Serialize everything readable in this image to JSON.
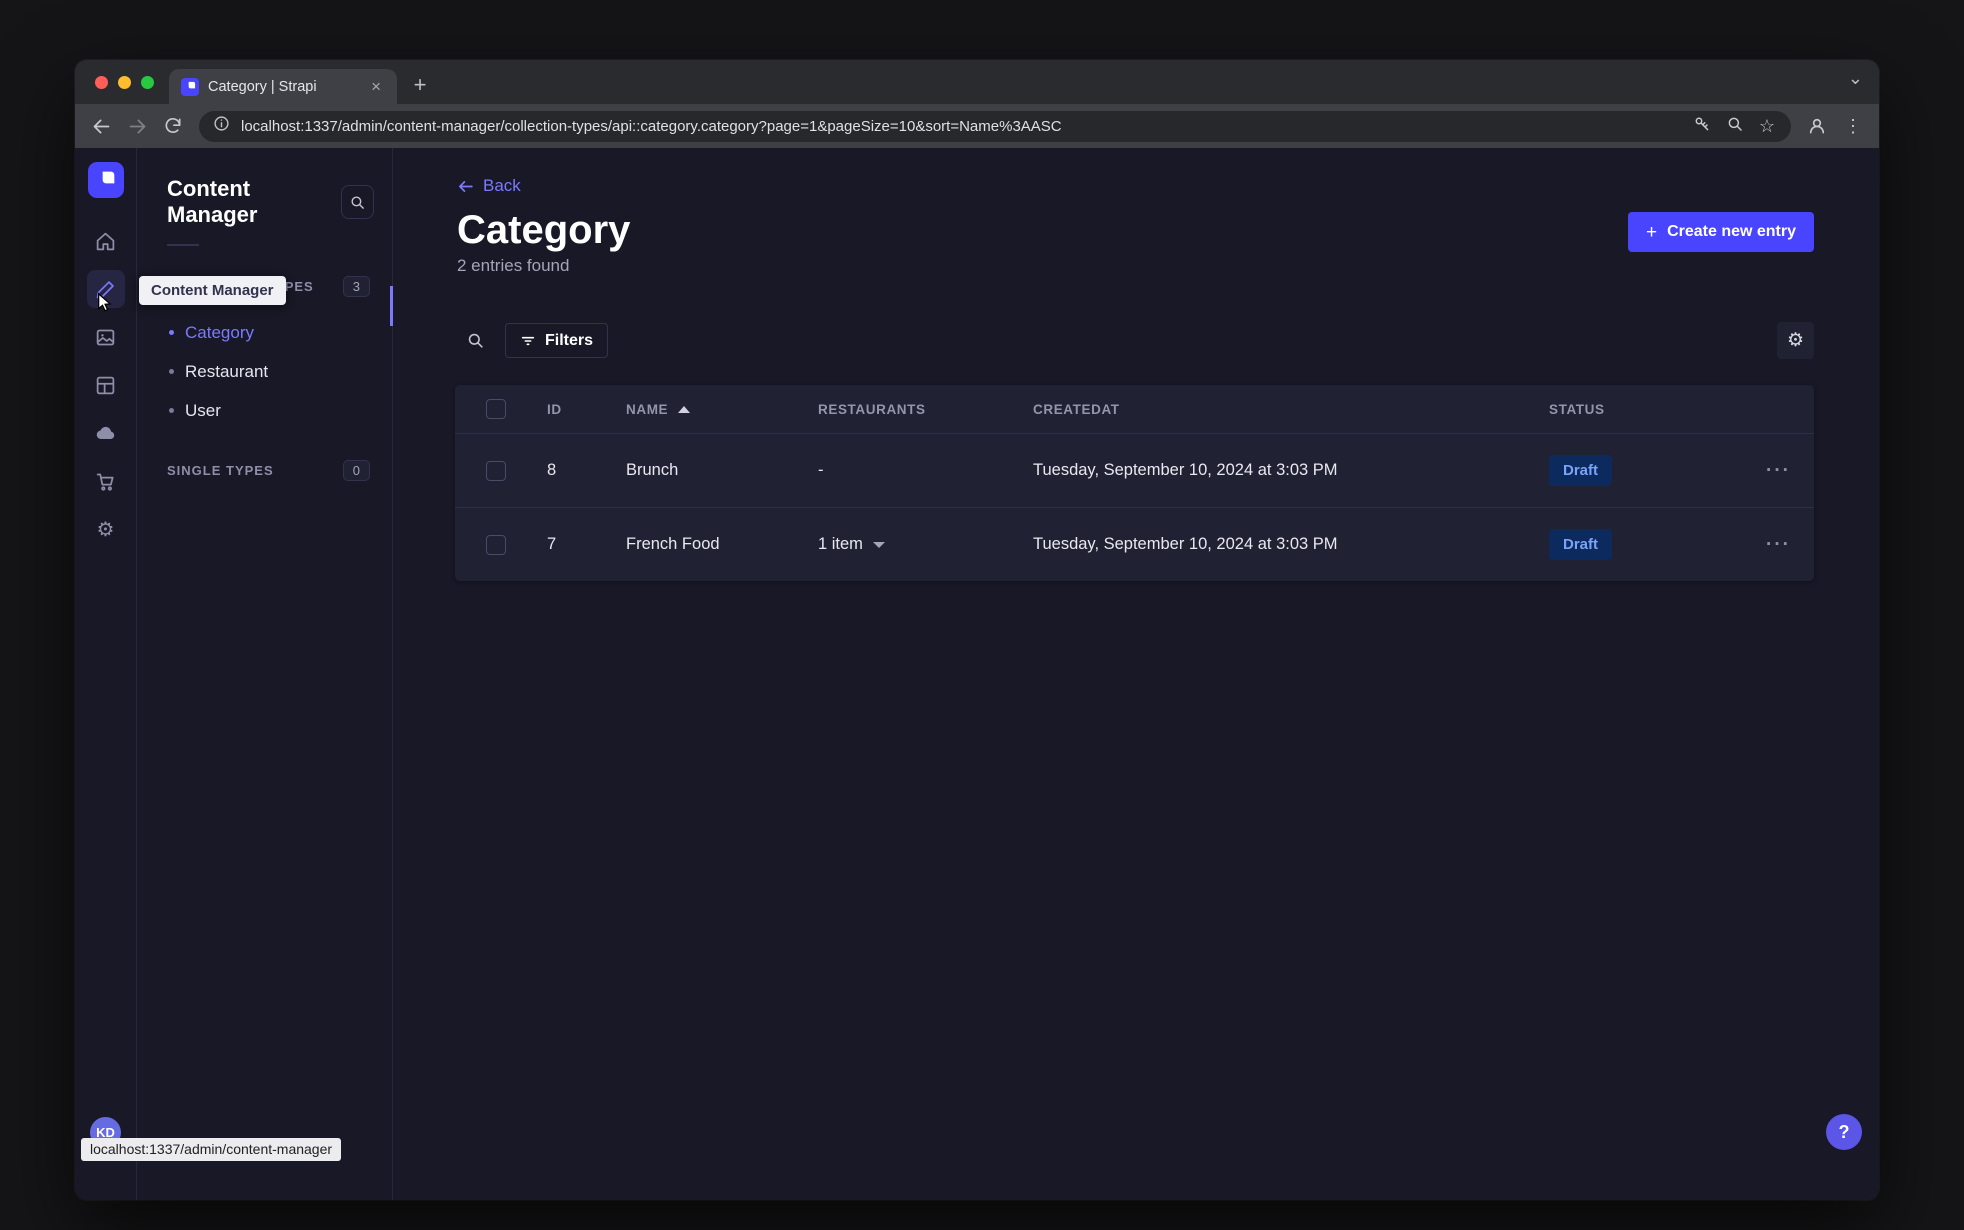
{
  "browser": {
    "tab_title": "Category | Strapi",
    "url": "localhost:1337/admin/content-manager/collection-types/api::category.category?page=1&pageSize=10&sort=Name%3AASC",
    "status_link_preview": "localhost:1337/admin/content-manager"
  },
  "glyphs": {
    "close": "×",
    "plus": "+",
    "kebab": "⋮",
    "row_ellipsis": "···",
    "question": "?",
    "star": "☆",
    "gear": "⚙",
    "chevron_down": "⌄"
  },
  "rail": {
    "tooltip": "Content Manager",
    "avatar_initials": "KD"
  },
  "sidebar": {
    "title": "Content Manager",
    "collection_types": {
      "label": "COLLECTION TYPES",
      "badge": "3",
      "items": [
        {
          "label": "Category",
          "active": true
        },
        {
          "label": "Restaurant",
          "active": false
        },
        {
          "label": "User",
          "active": false
        }
      ]
    },
    "single_types": {
      "label": "SINGLE TYPES",
      "badge": "0"
    }
  },
  "content": {
    "back_label": "Back",
    "title": "Category",
    "subtitle": "2 entries found",
    "create_button_label": "Create new entry",
    "filters_label": "Filters"
  },
  "table": {
    "columns": {
      "id": "ID",
      "name": "NAME",
      "restaurants": "RESTAURANTS",
      "createdat": "CREATEDAT",
      "status": "STATUS"
    },
    "rows": [
      {
        "id": "8",
        "name": "Brunch",
        "restaurants": "-",
        "createdat": "Tuesday, September 10, 2024 at 3:03 PM",
        "status": "Draft"
      },
      {
        "id": "7",
        "name": "French Food",
        "restaurants": "1 item",
        "createdat": "Tuesday, September 10, 2024 at 3:03 PM",
        "status": "Draft"
      }
    ]
  },
  "colors": {
    "primary": "#4945ff",
    "primary_light": "#7b79ff",
    "draft_text": "#7ba3f8",
    "draft_bg": "#0c2a5e"
  }
}
